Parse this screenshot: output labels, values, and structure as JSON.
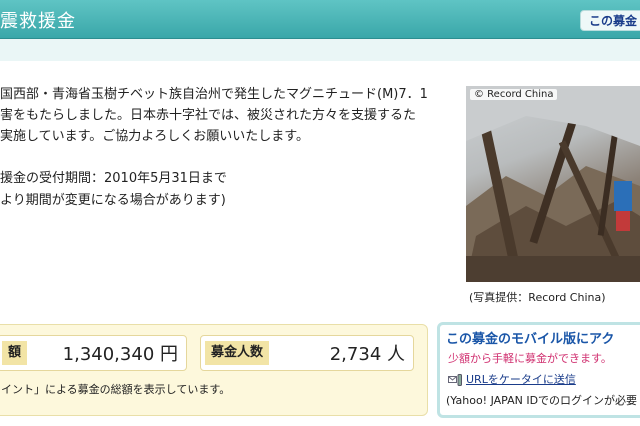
{
  "header": {
    "title": "震救援金",
    "top_link": "この募金"
  },
  "description": {
    "lines": [
      "国西部・青海省玉樹チベット族自治州で発生したマグニチュード(M)7．1",
      "害をもたらしました。日本赤十字社では、被災された方々を支援するた",
      "実施しています。ご協力よろしくお願いいたします。"
    ]
  },
  "period": {
    "line1": "援金の受付期間：2010年5月31日まで",
    "line2": "より期間が変更になる場合があります)"
  },
  "photo": {
    "badge": "© Record China",
    "caption": "(写真提供：Record China)"
  },
  "stats": {
    "amount_label": "額",
    "amount_value": "1,340,340 円",
    "donors_label": "募金人数",
    "donors_value": "2,734 人",
    "note": "イント」による募金の総額を表示しています。"
  },
  "mobile": {
    "title": "この募金のモバイル版にアク",
    "subtitle": "少額から手軽に募金ができます。",
    "link": "URLをケータイに送信",
    "note": "(Yahoo! JAPAN IDでのログインが必要"
  },
  "colors": {
    "header_bg": "#3aa7a9",
    "stats_bg": "#fdf8dc",
    "link_blue": "#1a56a8",
    "accent_pink": "#d03070"
  }
}
